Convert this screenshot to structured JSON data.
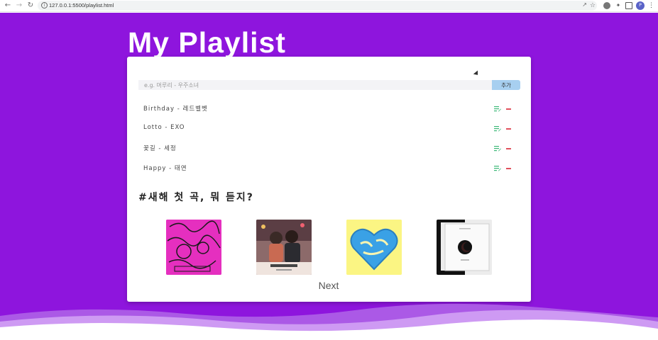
{
  "browser": {
    "url": "127.0.0.1:5500/playlist.html",
    "profile_initial": "P"
  },
  "page": {
    "title": "My Playlist",
    "search": {
      "placeholder": "e.g. 머루리 - 우주소녀",
      "value": ""
    },
    "add_label": "추가",
    "songs": [
      {
        "label": "Birthday - 레드벨벳"
      },
      {
        "label": "Lotto - EXO"
      },
      {
        "label": "꽃길 - 세정"
      },
      {
        "label": "Happy - 태연"
      }
    ],
    "section_title": "#새해 첫 곡, 뭐 듣지?",
    "albums": [
      {
        "color": "#e52fbf"
      },
      {
        "color": "#8c6a6a"
      },
      {
        "color": "#fbf583"
      },
      {
        "color": "#ececec"
      }
    ],
    "next_label": "Next"
  },
  "colors": {
    "background": "#8e15dd",
    "add_button": "#a7cff0",
    "delete_icon": "#e0505c",
    "edit_icon": "#3cb878"
  }
}
